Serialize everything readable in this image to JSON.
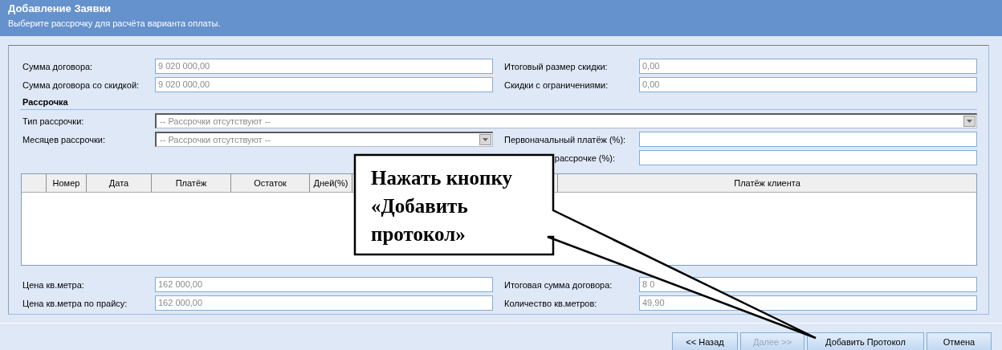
{
  "dialog": {
    "title": "Добавление Заявки",
    "subtitle": "Выберите рассрочку для расчёта варианта оплаты."
  },
  "top_fields": [
    {
      "label": "Сумма договора:",
      "value": "9 020 000,00"
    },
    {
      "label": "Итоговый размер скидки:",
      "value": "0,00"
    },
    {
      "label": "Сумма договора со скидкой:",
      "value": "9 020 000,00"
    },
    {
      "label": "Скидки с ограничениями:",
      "value": "0,00"
    }
  ],
  "installment": {
    "heading": "Рассрочка",
    "type_select": {
      "label": "Тип рассрочки:",
      "value": "-- Рассрочки отсутствуют --"
    },
    "months_select": {
      "label": "Месяцев рассрочки:",
      "value": "-- Рассрочки отсутствуют --"
    },
    "right_fields": [
      {
        "label": "Первоначальный платёж (%):"
      },
      {
        "label": "рассрочке (%):"
      }
    ]
  },
  "schedule_table": {
    "columns": [
      "Номер",
      "Дата",
      "Платёж",
      "Остаток",
      "Дней(%)",
      "Платёж клиента"
    ]
  },
  "bottom_fields": [
    {
      "label": "Цена кв.метра:",
      "value": "162 000,00"
    },
    {
      "label": "Итоговая сумма договора:",
      "value": "8 0"
    },
    {
      "label": "Цена кв.метра по прайсу:",
      "value": "162 000,00"
    },
    {
      "label": "Количество кв.метров:",
      "value": "49,90"
    }
  ],
  "buttons": [
    {
      "label": "<< Назад",
      "disabled": false
    },
    {
      "label": "Далее >>",
      "disabled": true
    },
    {
      "label": "Добавить Протокол",
      "disabled": false
    },
    {
      "label": "Отмена",
      "disabled": false
    }
  ],
  "callout": {
    "text": "Нажать кнопку «Добавить протокол»"
  }
}
